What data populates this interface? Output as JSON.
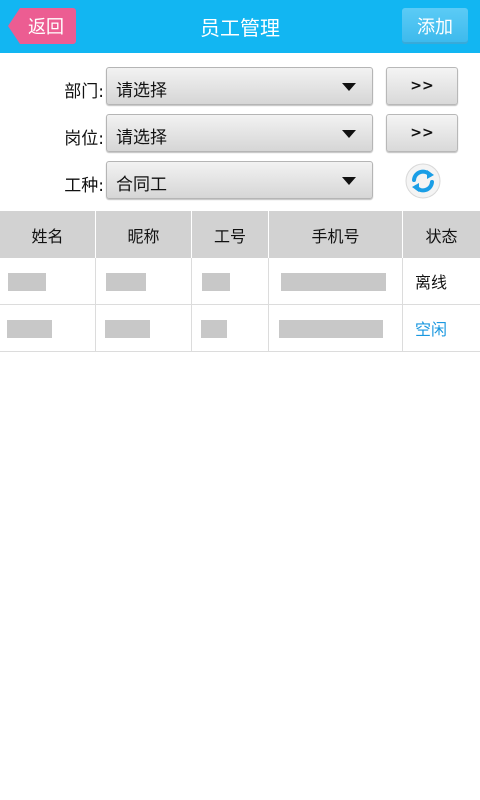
{
  "header": {
    "back_label": "返回",
    "title": "员工管理",
    "add_label": "添加"
  },
  "filters": {
    "department": {
      "label": "部门:",
      "value": "请选择",
      "jump_label": ">>"
    },
    "position": {
      "label": "岗位:",
      "value": "请选择",
      "jump_label": ">>"
    },
    "job_type": {
      "label": "工种:",
      "value": "合同工"
    }
  },
  "table": {
    "columns": [
      "姓名",
      "昵称",
      "工号",
      "手机号",
      "状态"
    ],
    "rows": [
      {
        "status": "离线",
        "status_color": "#111111"
      },
      {
        "status": "空闲",
        "status_color": "#1a98e0"
      }
    ]
  },
  "colors": {
    "titlebar": "#12b6f2",
    "back_button": "#ec5d92",
    "refresh_icon": "#1a9ee6"
  },
  "icons": {
    "refresh": "refresh-icon",
    "dropdown": "chevron-down-icon",
    "back": "back-arrow-shape"
  }
}
